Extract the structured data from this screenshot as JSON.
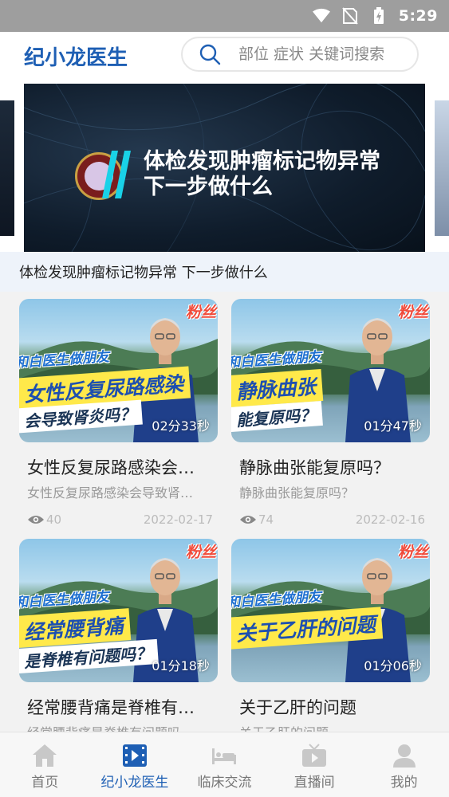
{
  "status_bar": {
    "time": "5:29"
  },
  "header": {
    "title": "纪小龙医生",
    "search_placeholder": "部位 症状 关键词搜索"
  },
  "banner": {
    "line1": "体检发现肿瘤标记物异常",
    "line2": "下一步做什么",
    "caption": "体检发现肿瘤标记物异常 下一步做什么"
  },
  "videos": [
    {
      "thumb_tag": "粉丝",
      "thumb_ribbon": "和白医生做朋友",
      "thumb_headline": "女性反复尿路感染",
      "thumb_subline": "会导致肾炎吗？",
      "duration": "02分33秒",
      "title": "女性反复尿路感染会导致肾炎吗？",
      "subtitle": "女性反复尿路感染会导致肾炎吗？",
      "views": "40",
      "date": "2022-02-17"
    },
    {
      "thumb_tag": "粉丝",
      "thumb_ribbon": "和白医生做朋友",
      "thumb_headline": "静脉曲张",
      "thumb_subline": "能复原吗？",
      "duration": "01分47秒",
      "title": "静脉曲张能复原吗？",
      "subtitle": "静脉曲张能复原吗？",
      "views": "74",
      "date": "2022-02-16"
    },
    {
      "thumb_tag": "粉丝",
      "thumb_ribbon": "和白医生做朋友",
      "thumb_headline": "经常腰背痛",
      "thumb_subline": "是脊椎有问题吗？",
      "duration": "01分18秒",
      "title": "经常腰背痛是脊椎有问题吗？",
      "subtitle": "经常腰背痛是脊椎有问题吗",
      "views": "",
      "date": ""
    },
    {
      "thumb_tag": "粉丝",
      "thumb_ribbon": "和白医生做朋友",
      "thumb_headline": "关于乙肝的问题",
      "thumb_subline": "",
      "duration": "01分06秒",
      "title": "关于乙肝的问题",
      "subtitle": "关于乙肝的问题",
      "views": "",
      "date": ""
    }
  ],
  "tabs": [
    {
      "label": "首页",
      "icon": "home-icon",
      "active": false
    },
    {
      "label": "纪小龙医生",
      "icon": "video-icon",
      "active": true
    },
    {
      "label": "临床交流",
      "icon": "bed-icon",
      "active": false
    },
    {
      "label": "直播间",
      "icon": "tv-icon",
      "active": false
    },
    {
      "label": "我的",
      "icon": "user-icon",
      "active": false
    }
  ],
  "colors": {
    "brand": "#1e5fb4",
    "status_bar": "#9e9e9e",
    "caption_bg": "#eef3fa"
  }
}
